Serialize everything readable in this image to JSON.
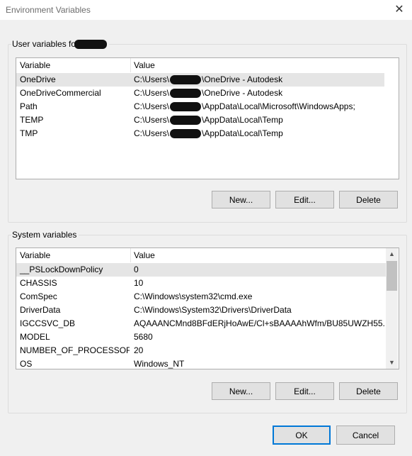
{
  "window": {
    "title": "Environment Variables",
    "close_glyph": "✕"
  },
  "user_vars": {
    "label": "User variables for",
    "columns": {
      "variable": "Variable",
      "value": "Value"
    },
    "rows": [
      {
        "name": "OneDrive",
        "value_pre": "C:\\Users\\",
        "value_post": "\\OneDrive - Autodesk"
      },
      {
        "name": "OneDriveCommercial",
        "value_pre": "C:\\Users\\",
        "value_post": "\\OneDrive - Autodesk"
      },
      {
        "name": "Path",
        "value_pre": "C:\\Users\\",
        "value_post": "\\AppData\\Local\\Microsoft\\WindowsApps;"
      },
      {
        "name": "TEMP",
        "value_pre": "C:\\Users\\",
        "value_post": "\\AppData\\Local\\Temp"
      },
      {
        "name": "TMP",
        "value_pre": "C:\\Users\\",
        "value_post": "\\AppData\\Local\\Temp"
      }
    ],
    "buttons": {
      "new": "New...",
      "edit": "Edit...",
      "delete": "Delete"
    }
  },
  "system_vars": {
    "label": "System variables",
    "columns": {
      "variable": "Variable",
      "value": "Value"
    },
    "rows": [
      {
        "name": "__PSLockDownPolicy",
        "value": "0"
      },
      {
        "name": "CHASSIS",
        "value": "10"
      },
      {
        "name": "ComSpec",
        "value": "C:\\Windows\\system32\\cmd.exe"
      },
      {
        "name": "DriverData",
        "value": "C:\\Windows\\System32\\Drivers\\DriverData"
      },
      {
        "name": "IGCCSVC_DB",
        "value": "AQAAANCMnd8BFdERjHoAwE/Cl+sBAAAAhWfm/BU85UWZH55..."
      },
      {
        "name": "MODEL",
        "value": "5680"
      },
      {
        "name": "NUMBER_OF_PROCESSORS",
        "value": "20"
      },
      {
        "name": "OS",
        "value": "Windows_NT"
      }
    ],
    "buttons": {
      "new": "New...",
      "edit": "Edit...",
      "delete": "Delete"
    },
    "scroll": {
      "up_glyph": "▲",
      "down_glyph": "▼"
    }
  },
  "dialog_buttons": {
    "ok": "OK",
    "cancel": "Cancel"
  },
  "colors": {
    "selected_row": "#e5e5e5",
    "default_button_border": "#0078d7",
    "background": "#f0f0f0"
  }
}
